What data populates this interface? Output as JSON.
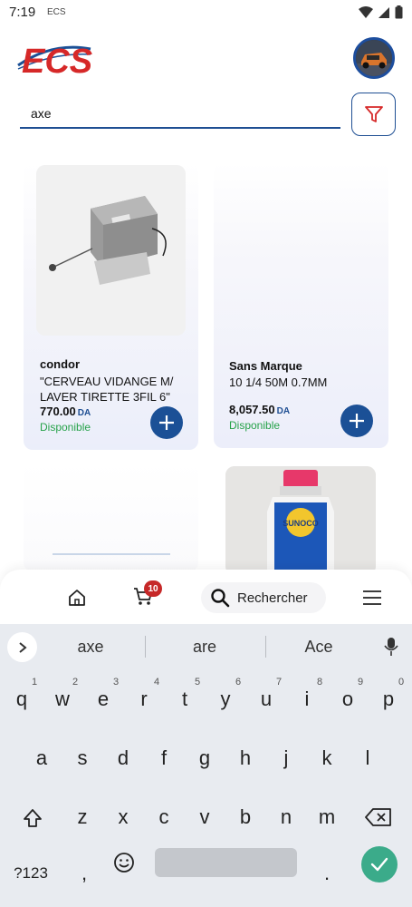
{
  "status_bar": {
    "time": "7:19",
    "app_indicator": "ECS"
  },
  "header": {
    "logo_text": "ECS"
  },
  "search": {
    "value": "axe",
    "placeholder": ""
  },
  "products": [
    {
      "brand": "condor",
      "name": "\"CERVEAU VIDANGE M/ LAVER TIRETTE 3FIL 6\"",
      "price": "770.00",
      "currency": "DA",
      "availability": "Disponible"
    },
    {
      "brand": "Sans Marque",
      "name": "10 1/4 50M 0.7MM",
      "price": "8,057.50",
      "currency": "DA",
      "availability": "Disponible"
    },
    {
      "brand": "",
      "name": "",
      "price": "",
      "currency": "",
      "availability": ""
    },
    {
      "brand": "SUNOCO",
      "name": "",
      "price": "",
      "currency": "",
      "availability": ""
    }
  ],
  "bottom_nav": {
    "cart_count": "10",
    "search_label": "Rechercher"
  },
  "keyboard": {
    "suggestions": [
      "axe",
      "are",
      "Ace"
    ],
    "row1": [
      "q",
      "w",
      "e",
      "r",
      "t",
      "y",
      "u",
      "i",
      "o",
      "p"
    ],
    "row1_hints": [
      "1",
      "2",
      "3",
      "4",
      "5",
      "6",
      "7",
      "8",
      "9",
      "0"
    ],
    "row2": [
      "a",
      "s",
      "d",
      "f",
      "g",
      "h",
      "j",
      "k",
      "l"
    ],
    "row3": [
      "z",
      "x",
      "c",
      "v",
      "b",
      "n",
      "m"
    ],
    "symbols_label": "?123",
    "comma": ",",
    "period": "."
  },
  "colors": {
    "brand_blue": "#1b5096",
    "brand_red": "#d62828",
    "available_green": "#27a24a",
    "badge_red": "#c62828",
    "enter_green": "#3bab8a"
  }
}
